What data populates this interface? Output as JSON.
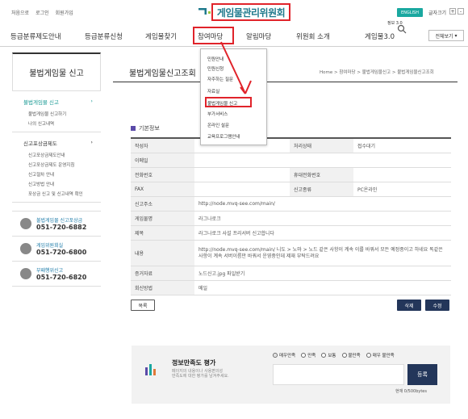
{
  "top_links": [
    "처음으로",
    "로그인",
    "회원가입"
  ],
  "logo": {
    "text": "게임물관리위원회"
  },
  "english_label": "ENGLISH",
  "font_size": {
    "label": "글자크기",
    "plus": "+",
    "minus": "-"
  },
  "nav": {
    "items": [
      "등급분류제도안내",
      "등급분류신청",
      "게임물찾기",
      "참여마당",
      "알림마당",
      "위원회 소개",
      "게임물3.0"
    ],
    "all_menu": "전체보기",
    "context_label": "정보 3.0"
  },
  "dropdown": {
    "items": [
      "민원안내",
      "민원신청",
      "자주하는 질문",
      "자료실",
      "불법게임물 신고",
      "부가서비스",
      "온라인 설문",
      "교육프로그램안내"
    ]
  },
  "sidebar": {
    "title": "불법게임물 신고",
    "sections": [
      {
        "label": "불법게임물 신고",
        "active": true,
        "subs": [
          "불법게임물 신고하기",
          "나의 신고내역"
        ]
      },
      {
        "label": "신고포상금제도",
        "active": false,
        "subs": [
          "신고포상금제도안내",
          "신고포상금제도 운영지침",
          "신고절차 안내",
          "신고방법 안내",
          "포상금 신고 및 신고내역 확인"
        ]
      }
    ],
    "contacts": [
      {
        "name": "불법게임물 신고포상금",
        "phone": "051-720-6882"
      },
      {
        "name": "게임위원회실",
        "phone": "051-720-6800"
      },
      {
        "name": "부패행위신고",
        "phone": "051-720-6820"
      }
    ]
  },
  "main": {
    "title": "불법게임물신고조회",
    "breadcrumb": "Home > 참여마당 > 불법게임물신고 > 불법게임물신고조회",
    "section_label": "기본정보",
    "rows": {
      "author_label": "작성자",
      "author": "",
      "status_label": "처리상태",
      "status": "접수대기",
      "email_label": "이메일",
      "email": "",
      "phone_label": "전화번호",
      "phone": "",
      "mobile_label": "휴대전화번호",
      "mobile": "",
      "fax_label": "FAX",
      "fax": "",
      "type_label": "신고종류",
      "type": "PC온라인",
      "address_label": "신고주소",
      "address": "http://node.mvq-see.com/main/",
      "game_label": "게임물명",
      "game": "라그나로크",
      "subject_label": "제목",
      "subject": "라그나로크 사설 프리서버 신고합니다",
      "content_label": "내용",
      "content": "http://node.mvq-see.com/main/ 니도 > 노마 > 노드 같은 사항이 계속 이를 바꿔서 모든 예정중이고 하네요 똑같은 사항이 계속 서버이름만 바꿔서 운영중인데 제재 부탁드려요",
      "evidence_label": "증거자료",
      "evidence": "노드신고.jpg 파일받기",
      "reply_label": "회신방법",
      "reply": "메일"
    },
    "buttons": {
      "list": "목록",
      "delete": "삭제",
      "edit": "수정"
    }
  },
  "satisfaction": {
    "title": "정보만족도 평가",
    "desc_line1": "페이지의 내용이나 사용편의성",
    "desc_line2": "만족도에 대한 평가를 남겨주세요.",
    "options": [
      "매우만족",
      "만족",
      "보통",
      "불만족",
      "매우 불만족"
    ],
    "selected": "매우만족",
    "submit": "등록",
    "count": "현재 0/500bytes"
  },
  "colors": {
    "accent": "#1aa8a0",
    "highlight": "#e0232a",
    "button_dark": "#23365a"
  }
}
